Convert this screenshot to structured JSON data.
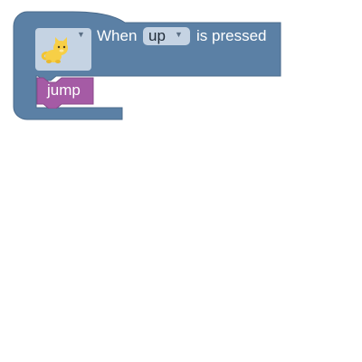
{
  "event_block": {
    "sprite_icon": "cat-icon",
    "when_label": "When",
    "key_value": "up",
    "pressed_label": "is pressed",
    "color": "#5b80a5",
    "field_color": "#c5d3e3"
  },
  "action_block": {
    "label": "jump",
    "color": "#a55ba5"
  }
}
